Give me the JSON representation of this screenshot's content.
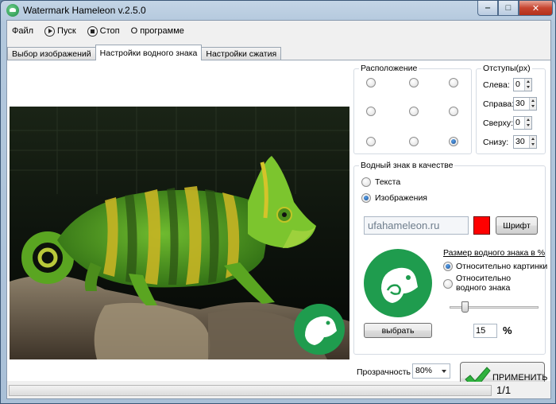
{
  "window": {
    "title": "Watermark Hameleon v.2.5.0",
    "minimize_glyph": "‒",
    "maximize_glyph": "□",
    "close_glyph": "✕"
  },
  "menu": {
    "file": "Файл",
    "start": "Пуск",
    "stop": "Стоп",
    "about": "О программе"
  },
  "tabs": [
    "Выбор изображений",
    "Настройки водного знака",
    "Настройки сжатия"
  ],
  "active_tab": 1,
  "position": {
    "title": "Расположение",
    "selected": "bottom-right"
  },
  "offsets": {
    "title": "Отступы(px)",
    "left_label": "Слева:",
    "left": "0",
    "right_label": "Справа:",
    "right": "30",
    "top_label": "Сверху:",
    "top": "0",
    "bottom_label": "Снизу:",
    "bottom": "30"
  },
  "watermark": {
    "title": "Водный знак в качестве",
    "opt_text": "Текста",
    "opt_image": "Изображения",
    "selected": "image",
    "text_value": "ufahameleon.ru",
    "text_color": "#ff0000",
    "font_button": "Шрифт",
    "choose_button": "выбрать",
    "size_title": "Размер водного знака в %",
    "size_rel_image": "Относительно картинки",
    "size_rel_wm_line1": "Относительно",
    "size_rel_wm_line2": "водного знака",
    "size_selected": "relative-to-image",
    "size_value": "15",
    "percent_sign": "%",
    "slider_value": 15
  },
  "transparency": {
    "label": "Прозрачность",
    "value": "80%"
  },
  "apply_button": "ПРИМЕНИТЬ",
  "status": {
    "counter": "1/1"
  },
  "colors": {
    "brand_green": "#1f9c4e",
    "apply_check": "#2fb23e"
  },
  "icons": [
    "app-chameleon-icon",
    "play-icon",
    "stop-icon",
    "checkmark-icon",
    "chameleon-logo-icon"
  ]
}
